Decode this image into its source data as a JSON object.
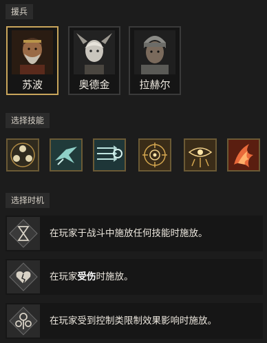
{
  "sections": {
    "mercenaries": "援兵",
    "skill_select": "选择技能",
    "timing_select": "选择时机"
  },
  "mercenaries": [
    {
      "name": "苏波",
      "selected": true
    },
    {
      "name": "奥德金",
      "selected": false
    },
    {
      "name": "拉赫尔",
      "selected": false
    }
  ],
  "skills": [
    {
      "icon": "skull-triad-icon"
    },
    {
      "icon": "bird-dive-icon"
    },
    {
      "icon": "arrow-volley-icon"
    },
    {
      "icon": "target-eye-icon"
    },
    {
      "icon": "all-seeing-eye-icon"
    },
    {
      "icon": "flame-burst-icon"
    }
  ],
  "timings": [
    {
      "text_pre": "在玩家于战斗中施放任何技能时施放。",
      "text_bold": "",
      "text_post": ""
    },
    {
      "text_pre": "在玩家",
      "text_bold": "受伤",
      "text_post": "时施放。"
    },
    {
      "text_pre": "在玩家受到控制类限制效果影响时施放。",
      "text_bold": "",
      "text_post": ""
    }
  ],
  "colors": {
    "selected_border": "#c9a65c",
    "background": "#1c1c1c"
  }
}
